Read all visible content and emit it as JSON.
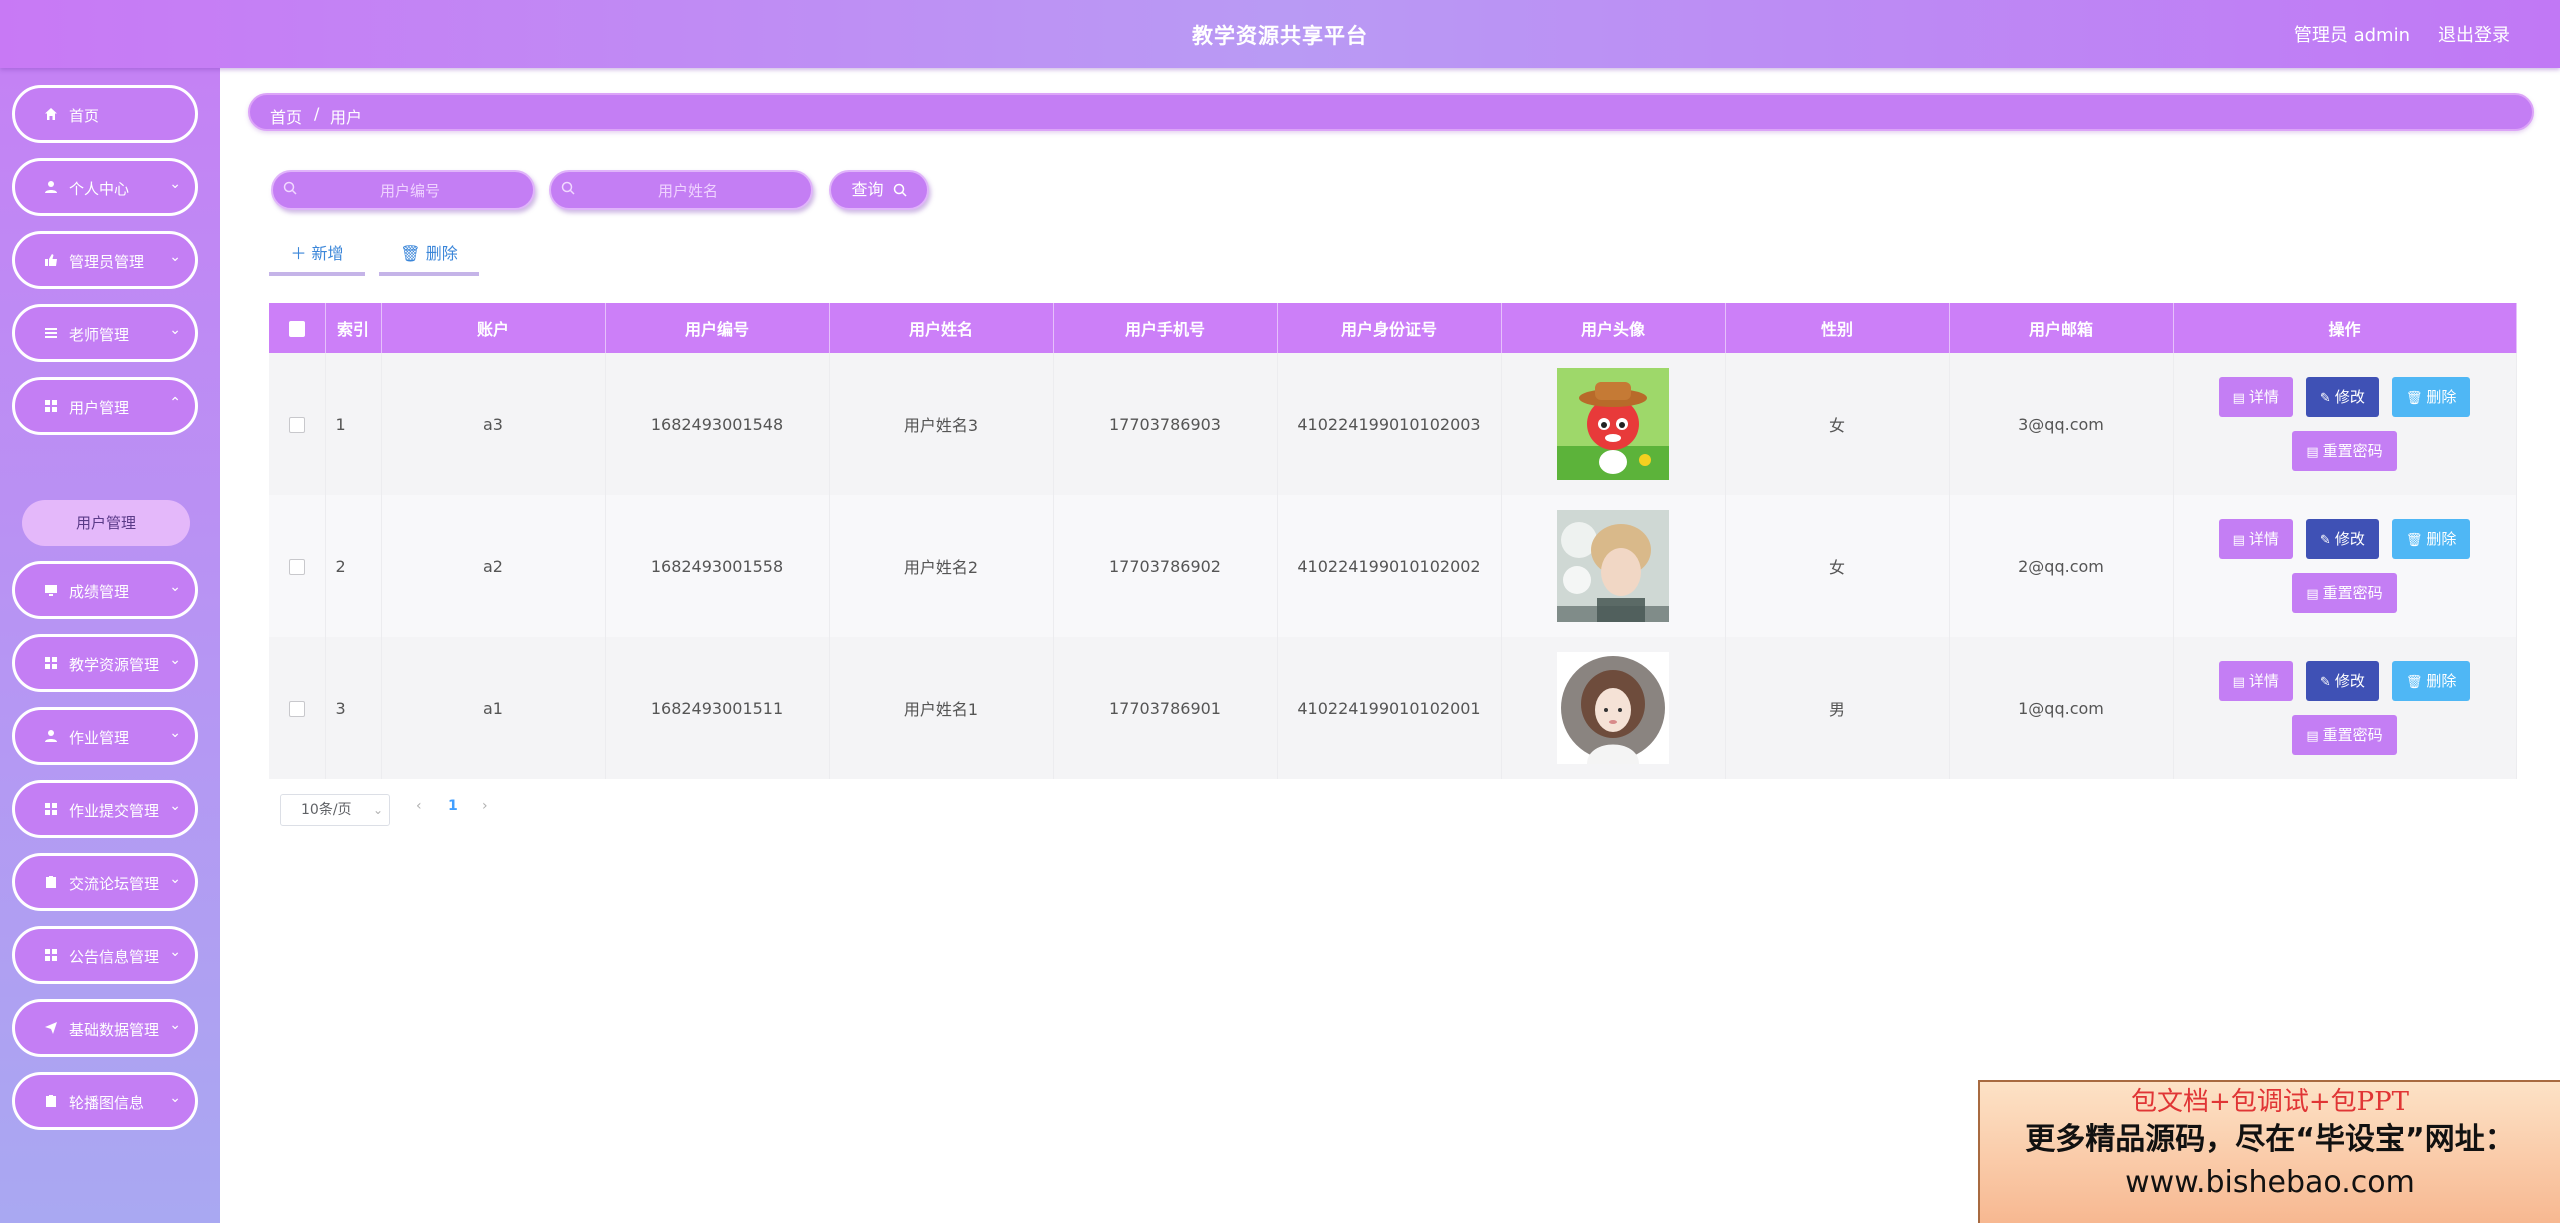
{
  "header": {
    "title": "教学资源共享平台",
    "user_label": "管理员 admin",
    "logout_label": "退出登录"
  },
  "sidebar": {
    "items": [
      {
        "label": "首页",
        "icon": "home-icon",
        "has_arrow": false
      },
      {
        "label": "个人中心",
        "icon": "user-icon",
        "has_arrow": true
      },
      {
        "label": "管理员管理",
        "icon": "thumb-icon",
        "has_arrow": true
      },
      {
        "label": "老师管理",
        "icon": "list-icon",
        "has_arrow": true
      },
      {
        "label": "用户管理",
        "icon": "grid-icon",
        "has_arrow": true
      },
      {
        "label": "成绩管理",
        "icon": "monitor-icon",
        "has_arrow": true
      },
      {
        "label": "教学资源管理",
        "icon": "grid-icon",
        "has_arrow": true
      },
      {
        "label": "作业管理",
        "icon": "user-icon",
        "has_arrow": true
      },
      {
        "label": "作业提交管理",
        "icon": "grid-icon",
        "has_arrow": true
      },
      {
        "label": "交流论坛管理",
        "icon": "clipboard-icon",
        "has_arrow": true
      },
      {
        "label": "公告信息管理",
        "icon": "grid-icon",
        "has_arrow": true
      },
      {
        "label": "基础数据管理",
        "icon": "send-icon",
        "has_arrow": true
      },
      {
        "label": "轮播图信息",
        "icon": "clipboard-icon",
        "has_arrow": true
      }
    ],
    "submenu_active": "用户管理"
  },
  "breadcrumb": {
    "home": "首页",
    "separator": "/",
    "current": "用户"
  },
  "search": {
    "user_no_placeholder": "用户编号",
    "user_name_placeholder": "用户姓名",
    "query_label": "查询"
  },
  "actions": {
    "add_label": "新增",
    "delete_label": "删除"
  },
  "table": {
    "columns": [
      "索引",
      "账户",
      "用户编号",
      "用户姓名",
      "用户手机号",
      "用户身份证号",
      "用户头像",
      "性别",
      "用户邮箱",
      "操作"
    ],
    "rows": [
      {
        "index": "1",
        "account": "a3",
        "user_no": "1682493001548",
        "name": "用户姓名3",
        "phone": "17703786903",
        "id_card": "410224199010102003",
        "avatar": "cartoon-avatar",
        "gender": "女",
        "email": "3@qq.com"
      },
      {
        "index": "2",
        "account": "a2",
        "user_no": "1682493001558",
        "name": "用户姓名2",
        "phone": "17703786902",
        "id_card": "410224199010102002",
        "avatar": "photo-avatar",
        "gender": "女",
        "email": "2@qq.com"
      },
      {
        "index": "3",
        "account": "a1",
        "user_no": "1682493001511",
        "name": "用户姓名1",
        "phone": "17703786901",
        "id_card": "410224199010102001",
        "avatar": "girl-avatar",
        "gender": "男",
        "email": "1@qq.com"
      }
    ],
    "ops": {
      "detail": "详情",
      "edit": "修改",
      "delete": "删除",
      "reset": "重置密码"
    }
  },
  "pagination": {
    "page_size": "10条/页",
    "current_page": "1",
    "prev": "‹",
    "next": "›"
  },
  "promo": {
    "line1": "包文档+包调试+包PPT",
    "line2": "更多精品源码，尽在“毕设宝”网址：",
    "line3": "www.bishebao.com"
  },
  "colors": {
    "primary": "#c47ef4",
    "table_header": "#cc7ff8",
    "edit_button": "#3f51b5",
    "delete_button": "#4fb7f5"
  }
}
